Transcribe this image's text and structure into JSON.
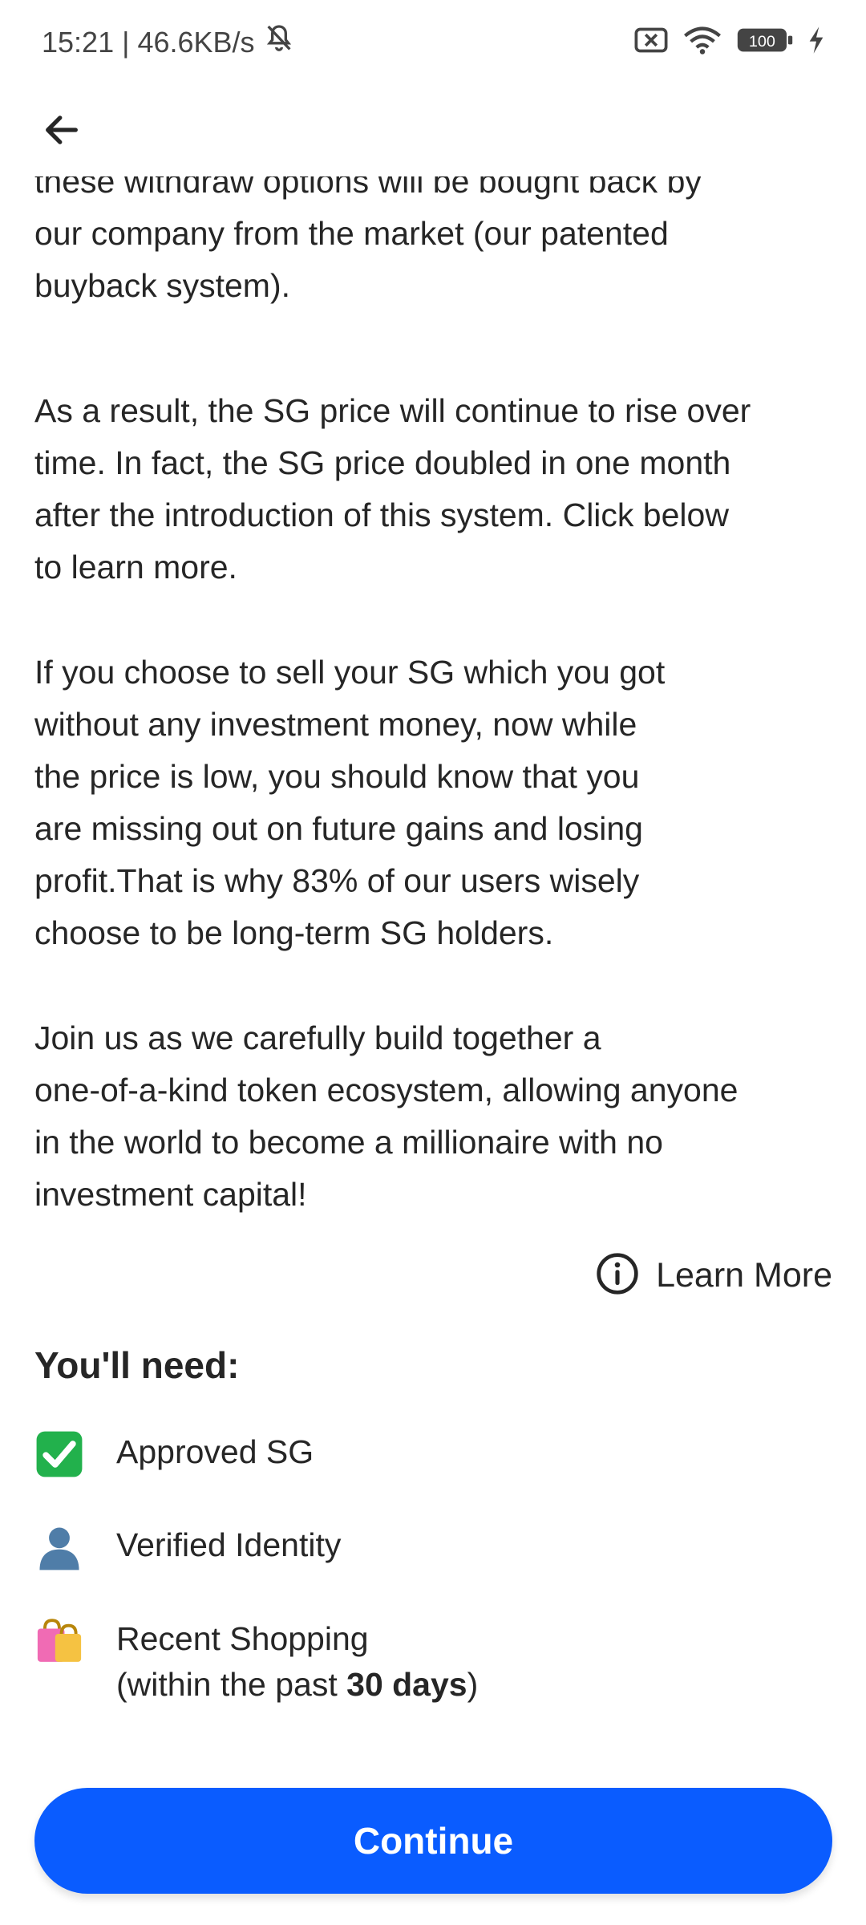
{
  "status_bar": {
    "time": "15:21",
    "separator": "|",
    "network_speed": "46.6KB/s",
    "battery": "100",
    "icons": [
      "bell-off-icon",
      "sim-x-icon",
      "wifi-icon",
      "battery-icon",
      "charging-icon"
    ]
  },
  "app_bar": {
    "back_icon": "arrow-left-icon"
  },
  "content": {
    "p1": [
      "these withdraw options will be bought back by",
      "our company from the market (our patented",
      "buyback system)."
    ],
    "p2": [
      "As a result, the SG price will continue to rise over",
      "time. In fact, the SG price doubled in one month",
      "after the introduction of this system. Click below",
      "to learn more."
    ],
    "p3": [
      "If you choose to sell your SG which you got",
      "without any investment money, now while",
      "the price is low, you should know that you",
      "are missing out on future gains and losing",
      "profit.That is why 83% of our users wisely",
      "choose to be long-term SG holders."
    ],
    "p4": [
      "Join us as we carefully build together a",
      "one-of-a-kind token ecosystem, allowing anyone",
      "in the world to become a millionaire with no",
      "investment capital!"
    ]
  },
  "learn_more": {
    "label": "Learn More",
    "icon": "info-icon"
  },
  "requirements": {
    "title": "You'll need:",
    "items": [
      {
        "icon": "check-mark-icon",
        "label": "Approved SG"
      },
      {
        "icon": "person-icon",
        "label": "Verified Identity"
      },
      {
        "icon": "shopping-bags-icon",
        "label": "Recent Shopping",
        "sub_prefix": "(within the past ",
        "sub_bold": "30 days",
        "sub_suffix": ")"
      }
    ]
  },
  "continue_label": "Continue",
  "colors": {
    "primary": "#0a5cff",
    "text": "#262626",
    "check_bg": "#22b14c"
  }
}
